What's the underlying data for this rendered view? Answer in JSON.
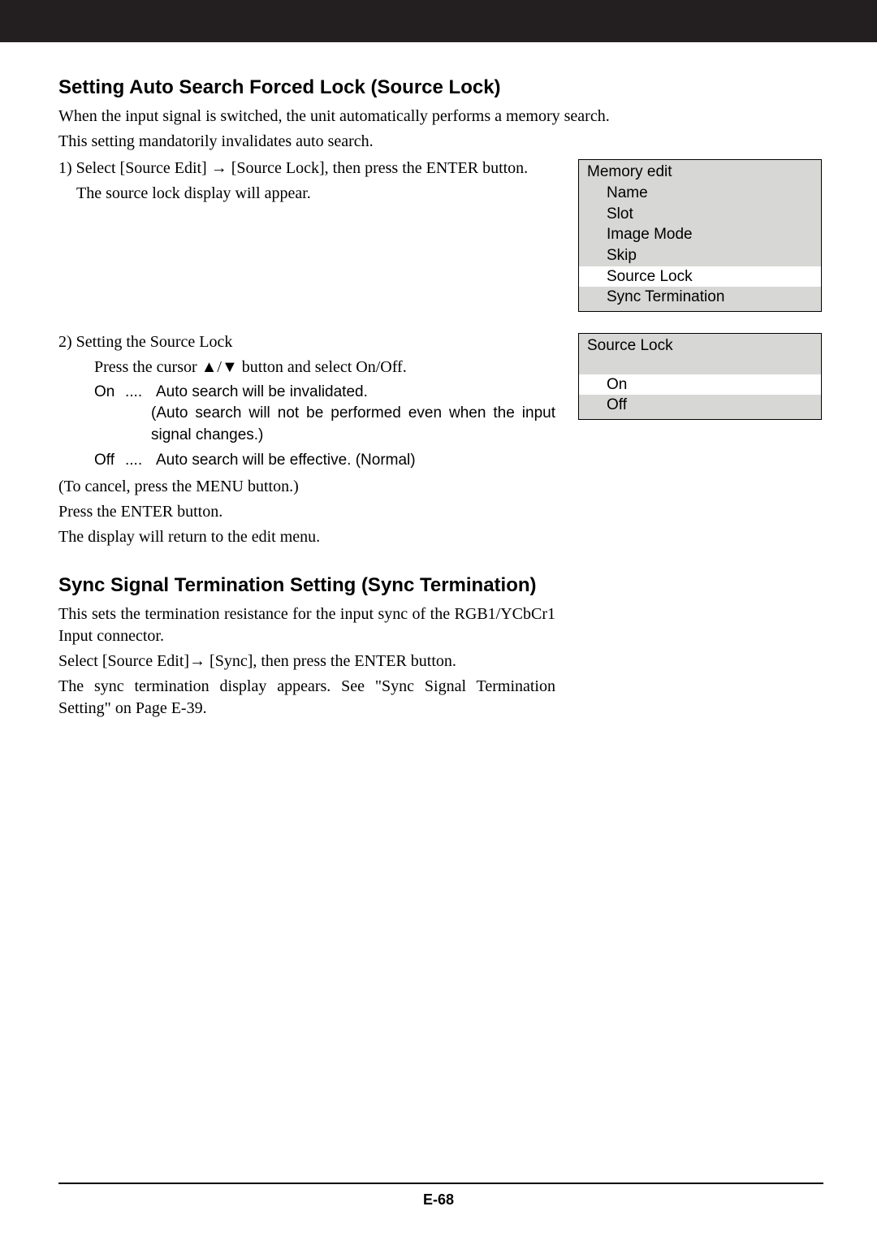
{
  "section1": {
    "heading": "Setting Auto Search Forced Lock (Source Lock)",
    "p1": "When the input signal is switched, the unit automatically performs a memory search.",
    "p2": "This setting mandatorily invalidates auto search.",
    "step1a": "1) Select [Source Edit] → [Source Lock], then press the ENTER button.",
    "step1b": "The source lock display will appear.",
    "step2a": "2) Setting the Source Lock",
    "step2b": "Press the cursor ▲/▼ button and select On/Off.",
    "on_label": "On",
    "off_label": "Off",
    "dots": "....",
    "on_text1": "Auto search will be invalidated.",
    "on_text2": "(Auto search will not be performed even when the input signal changes.)",
    "off_text": "Auto search will be effective. (Normal)",
    "cancel": "(To cancel, press the MENU button.)",
    "press": "Press the ENTER button.",
    "return": "The display will return to the edit menu."
  },
  "section2": {
    "heading": "Sync Signal Termination Setting (Sync Termination)",
    "p1": "This sets the termination resistance for the input sync of the RGB1/YCbCr1 Input connector.",
    "p2": "Select [Source Edit]→ [Sync], then press the ENTER button.",
    "p3": "The sync termination display appears. See \"Sync Signal Termination Setting\" on Page E-39."
  },
  "osd_memory": {
    "title": "Memory edit",
    "items": [
      "Name",
      "Slot",
      "Image Mode",
      "Skip",
      "Source Lock",
      "Sync Termination"
    ],
    "selected_index": 4
  },
  "osd_source": {
    "title": "Source Lock",
    "items": [
      "On",
      "Off"
    ],
    "selected_index": 0
  },
  "footer": {
    "page": "E-68"
  }
}
